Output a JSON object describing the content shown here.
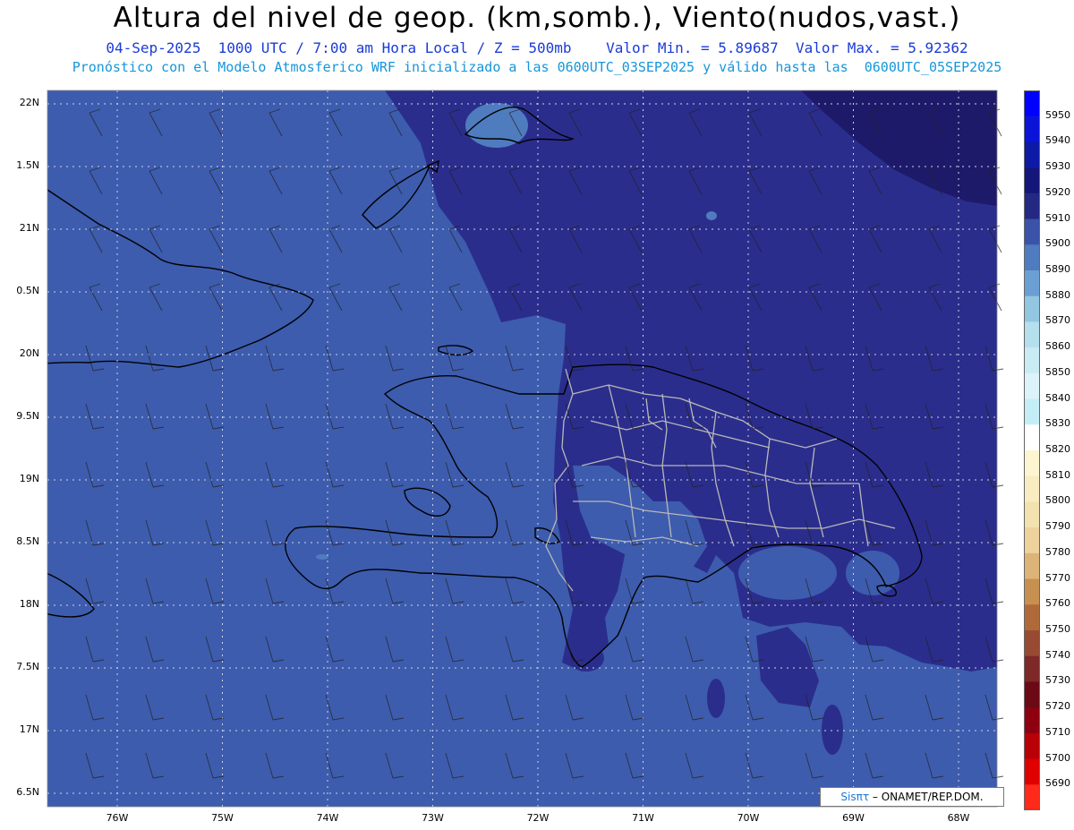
{
  "header": {
    "title": "Altura del nivel de geop. (km,somb.), Viento(nudos,vast.)",
    "line1": "04-Sep-2025  1000 UTC / 7:00 am Hora Local / Z = 500mb    Valor Min. = 5.89687  Valor Max. = 5.92362",
    "line2": "Pronóstico con el Modelo Atmosferico WRF inicializado a las 0600UTC_03SEP2025 y válido hasta las  0600UTC_05SEP2025"
  },
  "map": {
    "lat_labels": [
      "22N",
      "1.5N",
      "21N",
      "0.5N",
      "20N",
      "9.5N",
      "19N",
      "8.5N",
      "18N",
      "7.5N",
      "17N",
      "6.5N"
    ],
    "lon_labels": [
      "76W",
      "75W",
      "74W",
      "73W",
      "72W",
      "71W",
      "70W",
      "69W",
      "68W"
    ],
    "colors": {
      "sea_5900": "#3d5cae",
      "band_5910": "#2b2d8c",
      "band_5920": "#1e1a6a",
      "coast": "#000000",
      "borders": "#b8b8b8"
    }
  },
  "colorbar": {
    "levels": [
      "5950",
      "5940",
      "5930",
      "5920",
      "5910",
      "5900",
      "5890",
      "5880",
      "5870",
      "5860",
      "5850",
      "5840",
      "5830",
      "5820",
      "5810",
      "5800",
      "5790",
      "5780",
      "5770",
      "5760",
      "5750",
      "5740",
      "5730",
      "5720",
      "5710",
      "5700",
      "5690"
    ],
    "colors": [
      "#0000ff",
      "#0a14d8",
      "#0c1aa6",
      "#15167a",
      "#232882",
      "#3a53a8",
      "#4f7cbe",
      "#6a9fd3",
      "#93c6e0",
      "#b4e0ee",
      "#c9ecf4",
      "#dcf3fa",
      "#c4eef7",
      "#ffffff",
      "#fdf5cf",
      "#f8ecc0",
      "#f3e1b0",
      "#edd29c",
      "#dcb478",
      "#c79050",
      "#b06a3a",
      "#984a32",
      "#7e2828",
      "#6b0a14",
      "#8e0010",
      "#b80006",
      "#e00000",
      "#ff2a1a"
    ]
  },
  "credit": {
    "sis": "Sisπτ",
    "text": " – ONAMET/REP.DOM."
  }
}
